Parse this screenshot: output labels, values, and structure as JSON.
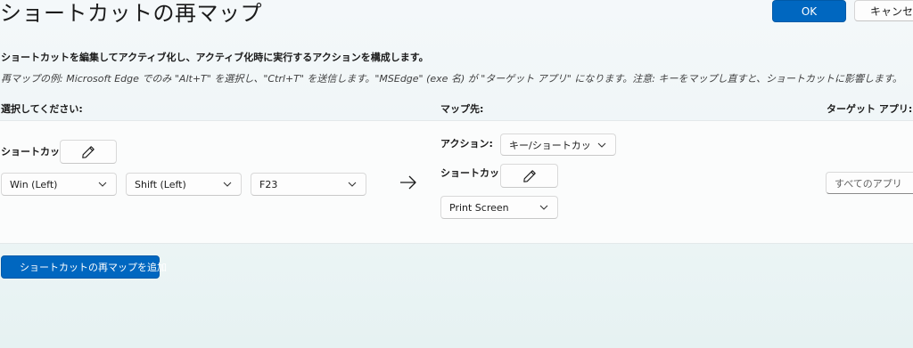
{
  "header": {
    "title": "ショートカットの再マップ",
    "ok_label": "OK",
    "cancel_label": "キャンセル"
  },
  "description": {
    "primary": "ショートカットを編集してアクティブ化し、アクティブ化時に実行するアクションを構成します。",
    "example": "再マップの例: Microsoft Edge でのみ \"Alt+T\" を選択し、\"Ctrl+T\" を送信します。\"MSEdge\" (exe 名) が \"ターゲット アプリ\" になります。注意: キーをマップし直すと、ショートカットに影響します。"
  },
  "columns": {
    "select": "選択してください:",
    "map_to": "マップ先:",
    "target_app": "ターゲット アプリ:"
  },
  "row": {
    "source": {
      "shortcut_label": "ショートカット:",
      "keys": [
        "Win (Left)",
        "Shift (Left)",
        "F23"
      ]
    },
    "destination": {
      "action_label": "アクション:",
      "action_value": "キー/ショートカットの送信",
      "shortcut_label": "ショートカット:",
      "key": "Print Screen"
    },
    "target_app_placeholder": "すべてのアプリ"
  },
  "footer": {
    "add_label": "ショートカットの再マップを追加"
  },
  "icons": {
    "edit": "pencil-icon",
    "arrow": "arrow-right-icon",
    "dropdown": "chevron-down-icon",
    "add": "plus-icon"
  },
  "colors": {
    "accent": "#0067c0",
    "panel": "#fbfcfc",
    "background": "#eef5f6"
  }
}
